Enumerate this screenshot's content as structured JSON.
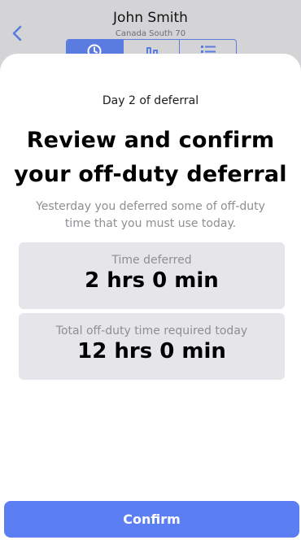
{
  "header": {
    "driver_name": "John Smith",
    "ruleset": "Canada South 70",
    "back_icon": "chevron-left-icon",
    "tabs": [
      {
        "icon": "clock-icon",
        "active": true
      },
      {
        "icon": "graph-icon",
        "active": false
      },
      {
        "icon": "list-icon",
        "active": false
      }
    ]
  },
  "sheet": {
    "day_label": "Day 2 of deferral",
    "title": "Review and confirm your off-duty deferral",
    "description": "Yesterday you deferred some of off-duty time that you must use today.",
    "cards": [
      {
        "label": "Time deferred",
        "value": "2 hrs 0 min"
      },
      {
        "label": "Total off-duty time required today",
        "value": "12 hrs 0 min"
      }
    ],
    "confirm_label": "Confirm"
  },
  "colors": {
    "accent": "#5b7ff2",
    "card_bg": "#e5e5ea",
    "muted_text": "#8e8e93"
  }
}
